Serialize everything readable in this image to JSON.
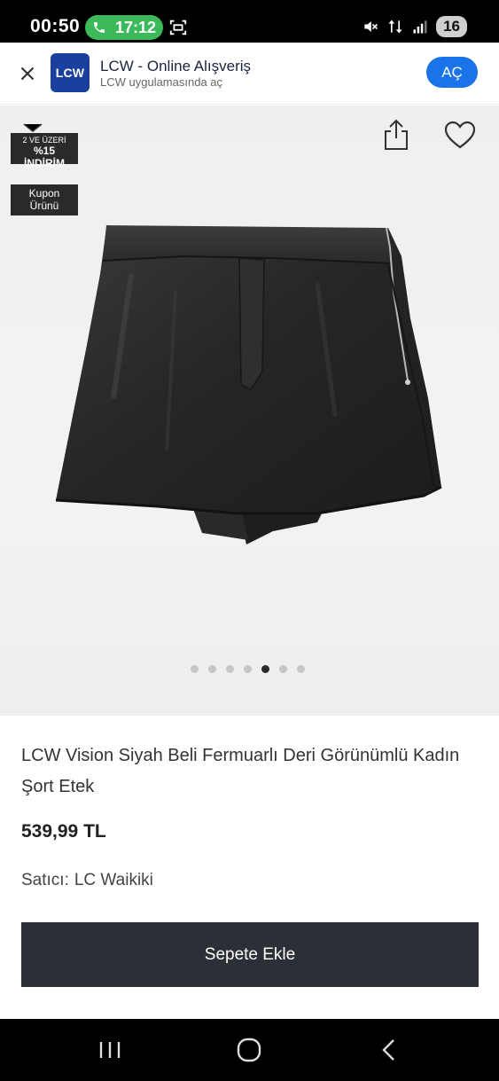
{
  "status_bar": {
    "time": "00:50",
    "call_time": "17:12",
    "battery": "16",
    "icons": [
      "phone-icon",
      "screen-record-icon",
      "mute-icon",
      "data-arrows-icon",
      "signal-icon"
    ]
  },
  "app_banner": {
    "logo_text": "LCW",
    "app_name": "LCW - Online Alışveriş",
    "subtitle": "LCW uygulamasında aç",
    "open_label": "AÇ",
    "accent_color": "#1a73e8"
  },
  "gallery": {
    "badge_discount_line1": "2 VE ÜZERİ",
    "badge_discount_line2": "%15 İNDİRİM",
    "badge_coupon_line1": "Kupon",
    "badge_coupon_line2": "Ürünü",
    "dot_count": 7,
    "active_dot_index": 4
  },
  "product": {
    "title": "LCW Vision Siyah Beli Fermuarlı Deri Görünümlü Kadın Şort Etek",
    "price": "539,99 TL",
    "seller_label": "Satıcı:",
    "seller_name": "LC Waikiki",
    "add_to_cart_label": "Sepete Ekle"
  }
}
